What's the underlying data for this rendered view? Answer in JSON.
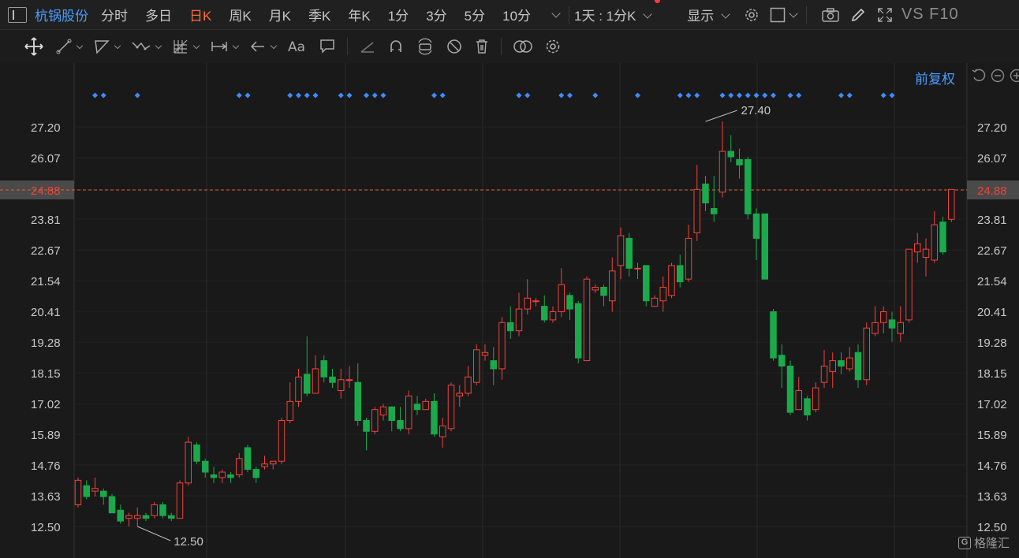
{
  "stock": {
    "name": "杭锅股份"
  },
  "tabs": [
    {
      "label": "分时"
    },
    {
      "label": "多日"
    },
    {
      "label": "日K",
      "active": true
    },
    {
      "label": "周K"
    },
    {
      "label": "月K"
    },
    {
      "label": "季K"
    },
    {
      "label": "年K"
    },
    {
      "label": "1分"
    },
    {
      "label": "3分"
    },
    {
      "label": "5分"
    },
    {
      "label": "10分"
    }
  ],
  "period_selector": "1天 : 1分K",
  "display_button": "显示",
  "vs_label": "VS F10",
  "adjust_mode": "前复权",
  "watermark": {
    "logo_letter": "G",
    "text": "格隆汇"
  },
  "colors": {
    "up": "#f0433c",
    "down": "#1ba94c",
    "active_tab": "#ff6a3d",
    "link_blue": "#4b9bff",
    "last_price_line": "#e5622f",
    "grid": "#2a2a2a",
    "marker": "#3d8bff"
  },
  "chart_data": {
    "type": "candlestick",
    "y_ticks": [
      "27.20",
      "26.07",
      "24.88",
      "23.81",
      "22.67",
      "21.54",
      "20.41",
      "19.28",
      "18.15",
      "17.02",
      "15.89",
      "14.76",
      "13.63",
      "12.50"
    ],
    "y_tick_values": [
      27.2,
      26.07,
      24.88,
      23.81,
      22.67,
      21.54,
      20.41,
      19.28,
      18.15,
      17.02,
      15.89,
      14.76,
      13.63,
      12.5
    ],
    "ylim": [
      12.0,
      28.4
    ],
    "last_price": 24.88,
    "last_price_label": "24.88",
    "max_label": "27.40",
    "max_value": 27.4,
    "max_index": 74,
    "min_label": "12.50",
    "min_value": 12.5,
    "min_index": 7,
    "candles": [
      [
        13.3,
        14.2,
        14.3,
        13.2
      ],
      [
        14.0,
        13.6,
        14.2,
        13.5
      ],
      [
        13.8,
        13.9,
        14.3,
        13.6
      ],
      [
        13.8,
        13.6,
        13.9,
        13.3
      ],
      [
        13.6,
        13.0,
        13.7,
        13.0
      ],
      [
        13.1,
        12.7,
        13.3,
        12.6
      ],
      [
        12.8,
        12.9,
        13.0,
        12.5
      ],
      [
        12.8,
        12.9,
        13.2,
        12.5
      ],
      [
        12.9,
        12.8,
        13.0,
        12.7
      ],
      [
        12.9,
        13.3,
        13.4,
        12.8
      ],
      [
        13.3,
        12.9,
        13.4,
        12.8
      ],
      [
        12.9,
        12.8,
        13.0,
        12.7
      ],
      [
        12.8,
        14.1,
        14.2,
        12.8
      ],
      [
        14.1,
        15.6,
        15.8,
        14.0
      ],
      [
        15.5,
        14.9,
        15.6,
        14.8
      ],
      [
        14.9,
        14.5,
        15.0,
        14.3
      ],
      [
        14.4,
        14.3,
        14.7,
        14.1
      ],
      [
        14.3,
        14.5,
        14.6,
        14.1
      ],
      [
        14.4,
        14.3,
        14.5,
        14.1
      ],
      [
        14.4,
        15.0,
        15.2,
        14.3
      ],
      [
        15.4,
        14.6,
        15.5,
        14.5
      ],
      [
        14.6,
        14.3,
        14.7,
        14.1
      ],
      [
        14.7,
        14.8,
        15.1,
        14.6
      ],
      [
        14.8,
        14.9,
        14.9,
        14.6
      ],
      [
        14.9,
        16.4,
        16.5,
        14.8
      ],
      [
        16.4,
        17.1,
        17.8,
        16.3
      ],
      [
        17.1,
        18.0,
        18.3,
        16.9
      ],
      [
        18.1,
        17.4,
        19.5,
        17.3
      ],
      [
        17.4,
        18.3,
        18.8,
        17.4
      ],
      [
        18.6,
        18.0,
        18.8,
        17.8
      ],
      [
        18.0,
        17.8,
        18.3,
        17.6
      ],
      [
        17.5,
        17.9,
        18.3,
        17.2
      ],
      [
        17.9,
        17.9,
        18.4,
        17.6
      ],
      [
        17.8,
        16.4,
        18.5,
        16.2
      ],
      [
        16.4,
        16.0,
        16.5,
        15.3
      ],
      [
        16.0,
        16.8,
        16.9,
        15.9
      ],
      [
        16.6,
        16.9,
        17.0,
        16.4
      ],
      [
        16.9,
        16.4,
        16.9,
        16.0
      ],
      [
        16.4,
        16.1,
        16.9,
        16.0
      ],
      [
        16.1,
        17.3,
        17.5,
        15.9
      ],
      [
        17.0,
        16.8,
        17.3,
        16.6
      ],
      [
        16.8,
        17.1,
        17.2,
        16.8
      ],
      [
        17.1,
        15.9,
        17.4,
        15.8
      ],
      [
        15.8,
        16.2,
        16.5,
        15.4
      ],
      [
        16.1,
        17.7,
        17.8,
        16.0
      ],
      [
        17.3,
        17.4,
        17.7,
        16.9
      ],
      [
        17.4,
        18.0,
        18.4,
        17.3
      ],
      [
        17.8,
        19.0,
        19.2,
        17.7
      ],
      [
        18.8,
        18.9,
        19.2,
        18.6
      ],
      [
        18.6,
        18.3,
        19.1,
        17.7
      ],
      [
        18.3,
        20.0,
        20.2,
        17.9
      ],
      [
        20.0,
        19.7,
        20.6,
        19.4
      ],
      [
        19.7,
        20.5,
        21.1,
        19.5
      ],
      [
        20.5,
        20.9,
        21.6,
        20.3
      ],
      [
        20.8,
        20.8,
        20.9,
        20.6
      ],
      [
        20.6,
        20.1,
        21.0,
        20.0
      ],
      [
        20.1,
        20.4,
        20.6,
        20.0
      ],
      [
        20.4,
        21.4,
        22.0,
        20.2
      ],
      [
        21.0,
        20.5,
        21.1,
        20.1
      ],
      [
        20.7,
        18.7,
        20.8,
        18.5
      ],
      [
        18.6,
        21.6,
        21.7,
        18.6
      ],
      [
        21.2,
        21.3,
        21.4,
        21.1
      ],
      [
        21.3,
        21.0,
        21.4,
        20.6
      ],
      [
        20.8,
        21.9,
        22.4,
        20.4
      ],
      [
        22.1,
        23.2,
        23.5,
        21.6
      ],
      [
        23.1,
        22.0,
        23.3,
        21.7
      ],
      [
        22.0,
        22.0,
        22.2,
        21.6
      ],
      [
        22.1,
        20.8,
        22.1,
        20.6
      ],
      [
        20.6,
        20.9,
        21.0,
        20.6
      ],
      [
        20.8,
        21.3,
        21.7,
        20.4
      ],
      [
        21.0,
        22.1,
        22.2,
        20.9
      ],
      [
        22.1,
        21.5,
        22.5,
        21.3
      ],
      [
        21.6,
        23.1,
        23.6,
        21.5
      ],
      [
        23.3,
        24.9,
        25.8,
        23.0
      ],
      [
        25.1,
        24.4,
        25.4,
        24.1
      ],
      [
        24.2,
        24.0,
        25.4,
        23.7
      ],
      [
        24.8,
        26.3,
        27.4,
        24.6
      ],
      [
        26.3,
        26.1,
        26.9,
        25.9
      ],
      [
        26.0,
        25.8,
        26.4,
        25.3
      ],
      [
        26.0,
        24.0,
        26.1,
        23.8
      ],
      [
        24.0,
        23.1,
        24.2,
        22.3
      ],
      [
        24.0,
        21.6,
        24.0,
        21.6
      ],
      [
        20.4,
        18.7,
        20.5,
        18.6
      ],
      [
        18.8,
        18.4,
        19.2,
        17.6
      ],
      [
        18.4,
        16.7,
        18.6,
        16.6
      ],
      [
        16.8,
        17.5,
        18.0,
        16.9
      ],
      [
        17.2,
        16.6,
        17.3,
        16.4
      ],
      [
        16.8,
        17.6,
        17.8,
        16.7
      ],
      [
        17.8,
        18.4,
        19.0,
        17.6
      ],
      [
        18.2,
        18.6,
        18.9,
        17.6
      ],
      [
        18.6,
        18.4,
        18.9,
        18.1
      ],
      [
        18.3,
        18.7,
        19.1,
        18.2
      ],
      [
        18.9,
        17.9,
        19.2,
        17.6
      ],
      [
        17.9,
        19.8,
        20.0,
        17.7
      ],
      [
        19.6,
        20.0,
        20.6,
        19.5
      ],
      [
        20.0,
        20.4,
        20.6,
        19.6
      ],
      [
        20.1,
        19.8,
        20.4,
        19.3
      ],
      [
        19.6,
        20.0,
        20.6,
        19.3
      ],
      [
        20.1,
        22.7,
        22.7,
        20.0
      ],
      [
        22.6,
        22.9,
        23.3,
        22.2
      ],
      [
        22.4,
        22.7,
        23.1,
        21.7
      ],
      [
        22.3,
        23.6,
        24.1,
        22.2
      ],
      [
        23.7,
        22.6,
        23.9,
        22.5
      ],
      [
        23.8,
        24.9,
        24.9,
        23.7
      ]
    ],
    "markers": [
      2,
      3,
      7,
      19,
      20,
      25,
      26,
      27,
      28,
      31,
      32,
      34,
      35,
      36,
      42,
      43,
      52,
      53,
      57,
      58,
      61,
      66,
      71,
      72,
      73,
      76,
      77,
      78,
      79,
      80,
      81,
      82,
      84,
      85,
      90,
      91,
      95,
      96
    ]
  }
}
